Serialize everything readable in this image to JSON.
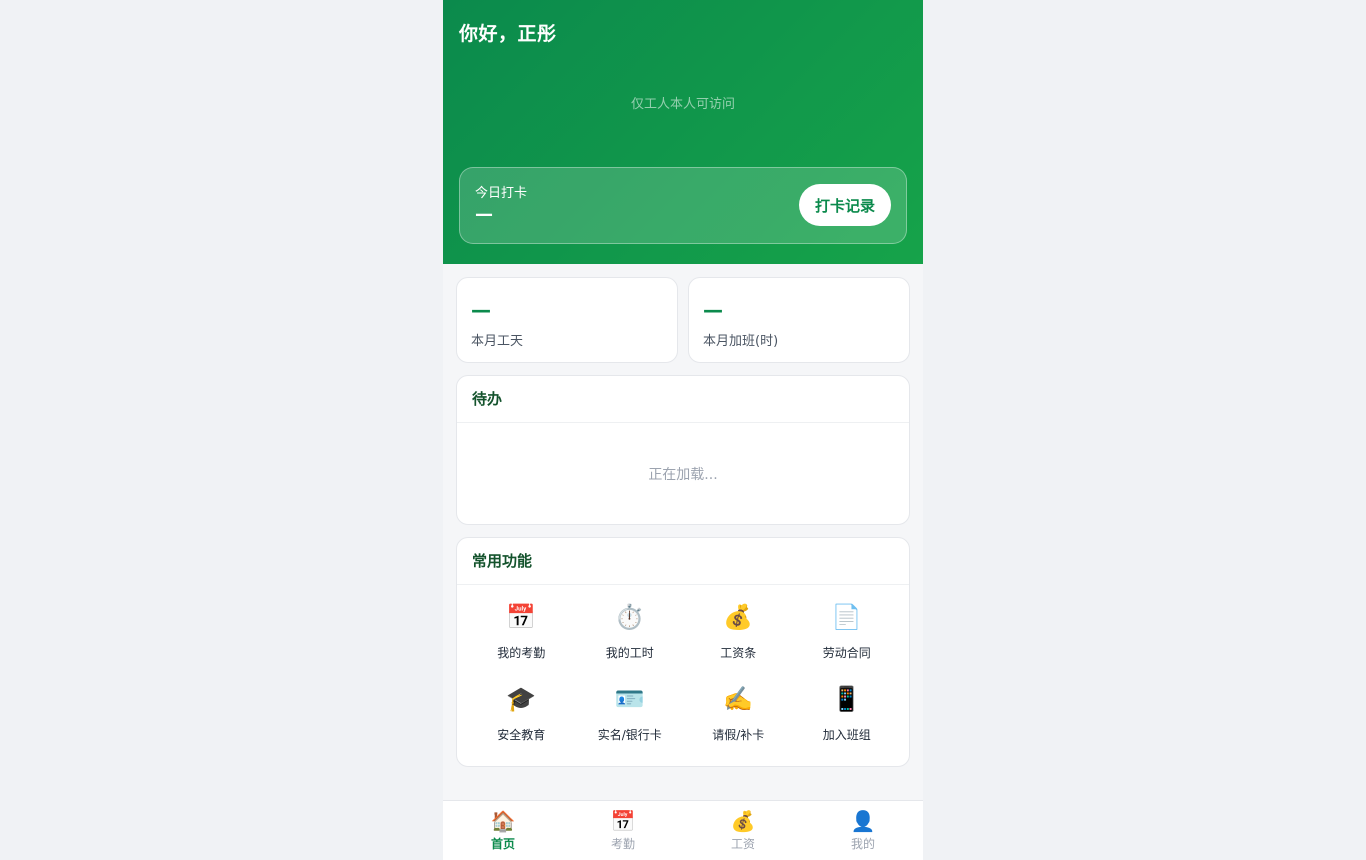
{
  "header": {
    "greeting": "你好，正彤",
    "access_note": "仅工人本人可访问"
  },
  "punch": {
    "title": "今日打卡",
    "value": "—",
    "button_label": "打卡记录"
  },
  "stats": [
    {
      "value": "—",
      "label": "本月工天"
    },
    {
      "value": "—",
      "label": "本月加班(时)"
    }
  ],
  "todo": {
    "title": "待办",
    "status": "正在加载..."
  },
  "functions": {
    "title": "常用功能",
    "items": [
      {
        "label": "我的考勤",
        "icon": "📅",
        "icon_name": "calendar-icon"
      },
      {
        "label": "我的工时",
        "icon": "⏱️",
        "icon_name": "stopwatch-icon"
      },
      {
        "label": "工资条",
        "icon": "💰",
        "icon_name": "money-bag-icon"
      },
      {
        "label": "劳动合同",
        "icon": "📄",
        "icon_name": "document-icon"
      },
      {
        "label": "安全教育",
        "icon": "🎓",
        "icon_name": "graduation-cap-icon"
      },
      {
        "label": "实名/银行卡",
        "icon": "🪪",
        "icon_name": "id-card-icon"
      },
      {
        "label": "请假/补卡",
        "icon": "✍️",
        "icon_name": "writing-hand-icon"
      },
      {
        "label": "加入班组",
        "icon": "📱",
        "icon_name": "mobile-phone-icon"
      }
    ]
  },
  "tabbar": {
    "items": [
      {
        "label": "首页",
        "icon": "🏠",
        "icon_name": "home-icon",
        "active": true
      },
      {
        "label": "考勤",
        "icon": "📅",
        "icon_name": "calendar-icon",
        "active": false
      },
      {
        "label": "工资",
        "icon": "💰",
        "icon_name": "money-bag-icon",
        "active": false
      },
      {
        "label": "我的",
        "icon": "👤",
        "icon_name": "user-icon",
        "active": false
      }
    ]
  },
  "colors": {
    "brand_green": "#0b8a4c",
    "header_gradient_end": "#16a34a",
    "page_background": "#f0f2f5"
  }
}
